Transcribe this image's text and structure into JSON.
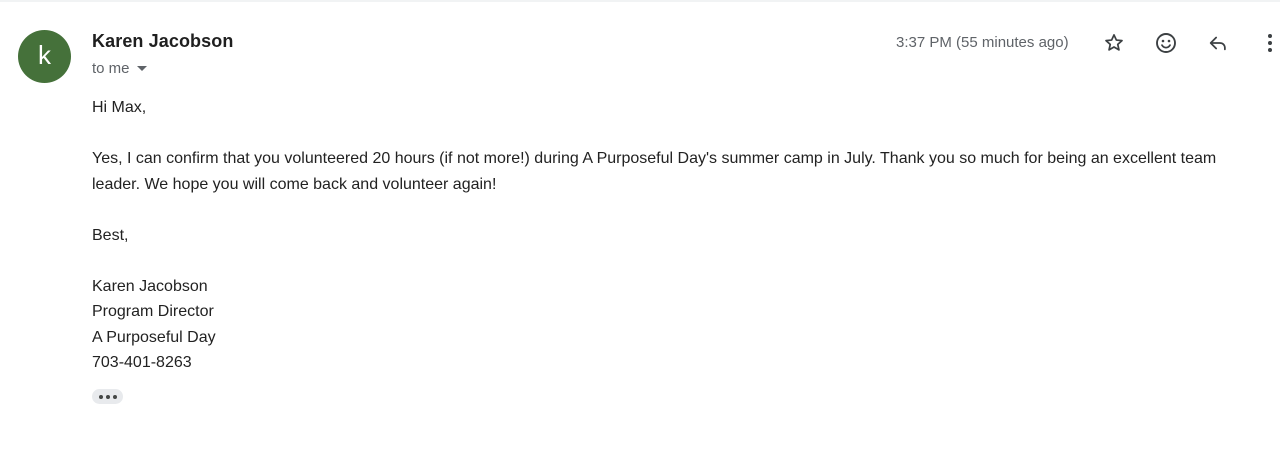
{
  "sender": {
    "avatar_letter": "k",
    "avatar_color": "#45713a",
    "name": "Karen Jacobson"
  },
  "recipient": {
    "label": "to me"
  },
  "timestamp": "3:37 PM (55 minutes ago)",
  "toolbar": {
    "star_icon": "star-icon",
    "emoji_icon": "emoji-reaction-icon",
    "reply_icon": "reply-icon",
    "more_icon": "more-vert-icon"
  },
  "message": {
    "greeting": "Hi Max,",
    "paragraph": "Yes, I can confirm that you volunteered 20 hours (if not more!) during A Purposeful Day's summer camp in July.  Thank you so much for being an excellent team leader.  We hope you will come back and volunteer again!",
    "closing": "Best,",
    "signature": [
      "Karen Jacobson",
      "Program Director",
      "A Purposeful Day",
      "703-401-8263"
    ]
  },
  "colors": {
    "text": "#222222",
    "muted": "#5f6368"
  }
}
